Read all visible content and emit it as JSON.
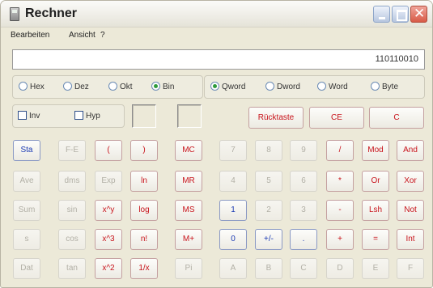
{
  "window": {
    "title": "Rechner"
  },
  "menu": [
    "Bearbeiten",
    "Ansicht",
    "?"
  ],
  "display": {
    "value": "110110010"
  },
  "number_system": {
    "options": [
      "Hex",
      "Dez",
      "Okt",
      "Bin"
    ],
    "selected": "Bin"
  },
  "word_size": {
    "options": [
      "Qword",
      "Dword",
      "Word",
      "Byte"
    ],
    "selected": "Qword"
  },
  "checks": {
    "inv": "Inv",
    "hyp": "Hyp"
  },
  "keys": {
    "backspace": "Rücktaste",
    "ce": "CE",
    "c": "C",
    "sta": "Sta",
    "fe": "F-E",
    "lparen": "(",
    "rparen": ")",
    "mc": "MC",
    "mr": "MR",
    "ms": "MS",
    "mplus": "M+",
    "d7": "7",
    "d8": "8",
    "d9": "9",
    "d4": "4",
    "d5": "5",
    "d6": "6",
    "d1": "1",
    "d2": "2",
    "d3": "3",
    "d0": "0",
    "plusminus": "+/-",
    "dot": ".",
    "div": "/",
    "mul": "*",
    "sub": "-",
    "add": "+",
    "eq": "=",
    "mod": "Mod",
    "and": "And",
    "or": "Or",
    "xor": "Xor",
    "lsh": "Lsh",
    "not": "Not",
    "int": "Int",
    "ave": "Ave",
    "dms": "dms",
    "exp": "Exp",
    "ln": "ln",
    "sum": "Sum",
    "sin": "sin",
    "pow": "x^y",
    "log": "log",
    "s": "s",
    "cos": "cos",
    "cube": "x^3",
    "fact": "n!",
    "dat": "Dat",
    "tan": "tan",
    "sq": "x^2",
    "inv": "1/x",
    "pi": "Pi",
    "hA": "A",
    "hB": "B",
    "hC": "C",
    "hD": "D",
    "hE": "E",
    "hF": "F"
  },
  "colors": {
    "blue_text": "#1b3ab3",
    "red_text": "#c8131b",
    "disabled_text": "#b2b0a6",
    "selected_radio": "#2e9b3c"
  }
}
